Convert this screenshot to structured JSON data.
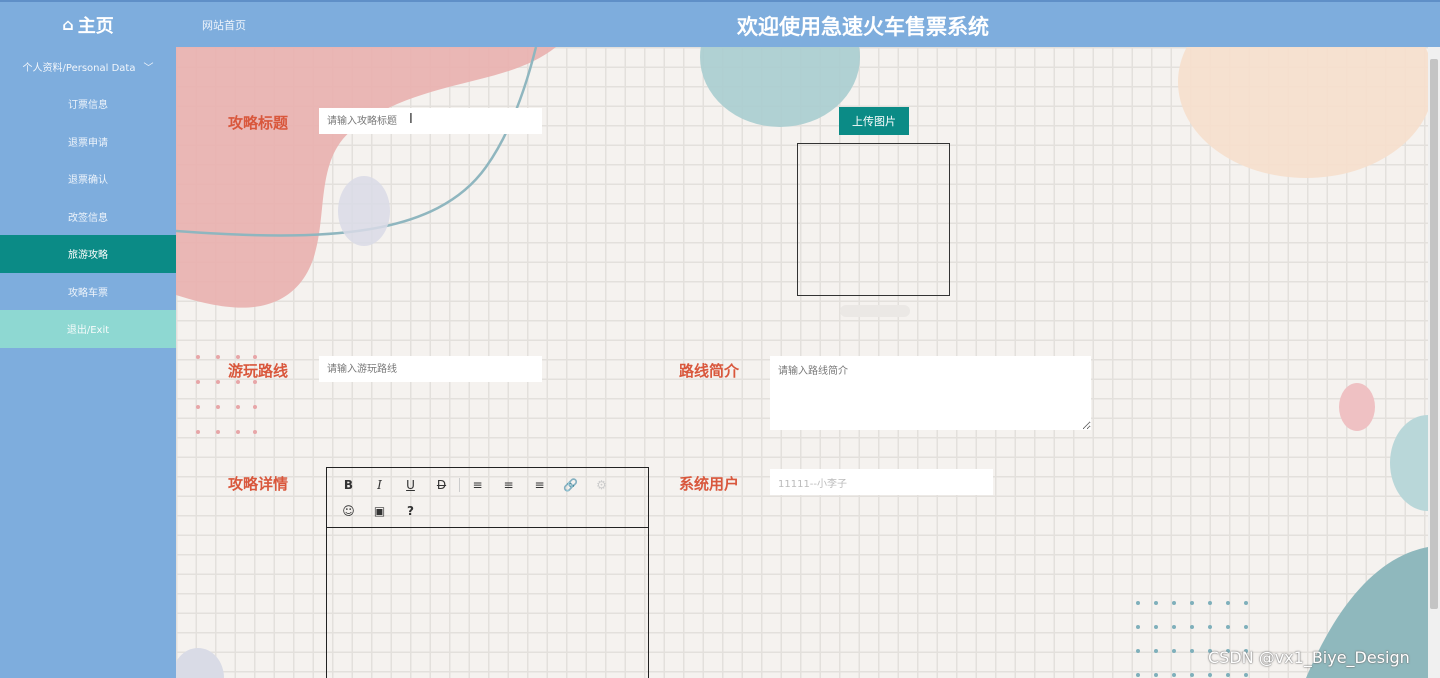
{
  "header": {
    "brand_icon": "home-icon",
    "brand_label": "主页",
    "nav_home": "网站首页",
    "title": "欢迎使用急速火车售票系统"
  },
  "sidebar": {
    "group_label": "个人资料/Personal Data",
    "items": [
      {
        "label": "订票信息"
      },
      {
        "label": "退票申请"
      },
      {
        "label": "退票确认"
      },
      {
        "label": "改签信息"
      },
      {
        "label": "旅游攻略",
        "active": true
      },
      {
        "label": "攻略车票"
      },
      {
        "label": "退出/Exit"
      }
    ]
  },
  "form": {
    "title_label": "攻略标题",
    "title_placeholder": "请输入攻略标题",
    "upload_label": "上传图片",
    "route_label": "游玩路线",
    "route_placeholder": "请输入游玩路线",
    "intro_label": "路线简介",
    "intro_placeholder": "请输入路线简介",
    "details_label": "攻略详情",
    "user_label": "系统用户",
    "user_value": "11111--小李子"
  },
  "editor": {
    "help_label": "?"
  },
  "watermark": "CSDN @vx1_Biye_Design",
  "colors": {
    "header_bg": "#7eaddd",
    "active_item": "#0b8b86",
    "exit_item": "#8ed8d2",
    "label_text": "#d9573c"
  }
}
